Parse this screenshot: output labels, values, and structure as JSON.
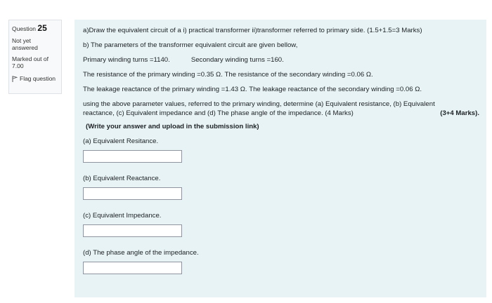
{
  "info": {
    "question_prefix": "Question",
    "question_number": "25",
    "status": "Not yet answered",
    "marked_out_of": "Marked out of 7.00",
    "flag_label": "Flag question"
  },
  "question": {
    "part_a": "a)Draw the equivalent circuit of a  i) practical transformer  ii)transformer referred to primary side. (1.5+1.5=3 Marks)",
    "part_b": "b) The parameters of the transformer equivalent circuit are given bellow,",
    "primary_turns": "Primary winding turns =1140.",
    "secondary_turns": "Secondary winding turns =160.",
    "resistance": "The resistance of the primary winding =0.35 Ω.  The resistance of the secondary winding =0.06 Ω.",
    "reactance": "The leakage reactance of the primary winding =1.43 Ω. The leakage reactance of the secondary winding =0.06 Ω.",
    "determine_line1": "using the above parameter values, referred to the primary winding, determine (a) Equivalent resistance, (b) Equivalent",
    "determine_line2": "reactance, (c) Equivalent impedance  and (d) The phase angle of the impedance.    (4 Marks)",
    "total_marks": "(3+4 Marks).",
    "instruction": "(Write your answer and upload in the submission link)",
    "answers": [
      {
        "label": "(a) Equivalent Resitance.",
        "value": ""
      },
      {
        "label": "(b) Equivalent Reactance.",
        "value": ""
      },
      {
        "label": "(c) Equivalent  Impedance.",
        "value": ""
      },
      {
        "label": "(d) The phase angle of the impedance.",
        "value": ""
      }
    ]
  }
}
